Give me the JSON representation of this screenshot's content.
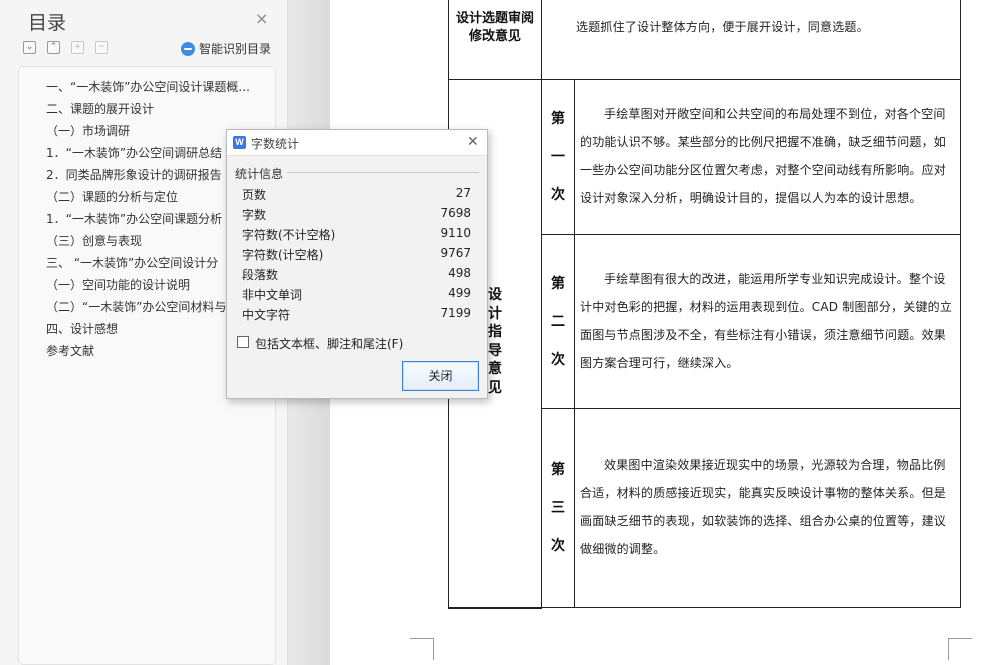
{
  "toc": {
    "title": "目录",
    "close_icon": "×",
    "tools": [
      "collapse-all",
      "expand-all",
      "add-heading",
      "remove-heading"
    ],
    "smart_label": "智能识别目录",
    "items": [
      "一、“一木装饰”办公空间设计课题概...",
      "二、课题的展开设计",
      "（一）市场调研",
      "1．“一木装饰”办公空间调研总结",
      "2．同类品牌形象设计的调研报告",
      "（二）课题的分析与定位",
      "1．“一木装饰”办公空间课题分析",
      "（三）创意与表现",
      "三、 “一木装饰”办公空间设计分",
      "（一）空间功能的设计说明",
      "（二）“一木装饰”办公空间材料与",
      "四、设计感想",
      "参考文献"
    ]
  },
  "dialog": {
    "title": "字数统计",
    "logo": "W",
    "section": "统计信息",
    "stats": [
      {
        "label": "页数",
        "value": "27"
      },
      {
        "label": "字数",
        "value": "7698"
      },
      {
        "label": "字符数(不计空格)",
        "value": "9110"
      },
      {
        "label": "字符数(计空格)",
        "value": "9767"
      },
      {
        "label": "段落数",
        "value": "498"
      },
      {
        "label": "非中文单词",
        "value": "499"
      },
      {
        "label": "中文字符",
        "value": "7199"
      }
    ],
    "checkbox_label": "包括文本框、脚注和尾注(F)",
    "checkbox_checked": false,
    "close_button": "关闭"
  },
  "document": {
    "review": {
      "label": "设计选题审阅修改意见",
      "text": "选题抓住了设计整体方向，便于展开设计，同意选题。"
    },
    "guidance_label_visible": [
      "设",
      "计",
      "指",
      "导",
      "意",
      "见"
    ],
    "rounds": [
      {
        "ordinal": [
          "第",
          "一",
          "次"
        ],
        "text": "手绘草图对开敞空间和公共空间的布局处理不到位，对各个空间的功能认识不够。某些部分的比例尺把握不准确，缺乏细节问题，如一些办公空间功能分区位置欠考虑，对整个空间动线有所影响。应对设计对象深入分析，明确设计目的，提倡以人为本的设计思想。"
      },
      {
        "ordinal": [
          "第",
          "二",
          "次"
        ],
        "text": "手绘草图有很大的改进，能运用所学专业知识完成设计。整个设计中对色彩的把握，材料的运用表现到位。CAD 制图部分，关键的立面图与节点图涉及不全，有些标注有小错误，须注意细节问题。效果图方案合理可行，继续深入。"
      },
      {
        "ordinal": [
          "第",
          "三",
          "次"
        ],
        "text": "效果图中渲染效果接近现实中的场景，光源较为合理，物品比例合适，材料的质感接近现实，能真实反映设计事物的整体关系。但是画面缺乏细节的表现，如软装饰的选择、组合办公桌的位置等，建议做细微的调整。"
      }
    ]
  }
}
